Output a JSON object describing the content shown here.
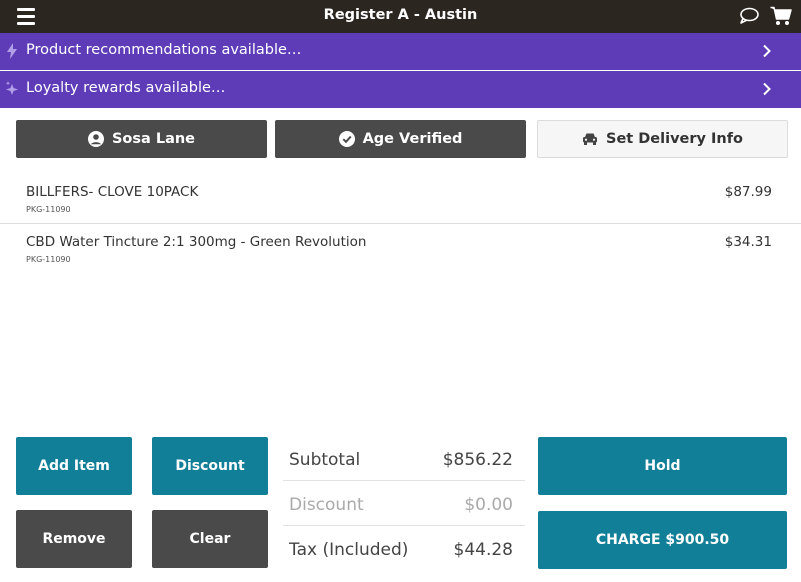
{
  "header": {
    "title": "Register A - Austin",
    "menu_icon": "hamburger-icon",
    "chat_icon": "chat-bubble-icon",
    "cart_icon": "cart-icon",
    "background": "#2c2621"
  },
  "banners": [
    {
      "text": "Product recommendations available…",
      "icon": "lightning-icon"
    },
    {
      "text": "Loyalty rewards available…",
      "icon": "sparkle-icon"
    }
  ],
  "banner_color": "#5e3cb8",
  "actions": {
    "customer": {
      "label": "Sosa Lane",
      "icon": "user-circle-icon"
    },
    "age": {
      "label": "Age Verified",
      "icon": "check-circle-icon"
    },
    "delivery": {
      "label": "Set Delivery Info",
      "icon": "car-icon"
    }
  },
  "cart_items": [
    {
      "name": "BILLFERS- CLOVE 10PACK",
      "sku": "PKG-11090",
      "price": "$87.99"
    },
    {
      "name": "CBD Water Tincture 2:1 300mg - Green Revolution",
      "sku": "PKG-11090",
      "price": "$34.31"
    }
  ],
  "buttons": {
    "add_item": "Add Item",
    "discount": "Discount",
    "remove": "Remove",
    "clear": "Clear",
    "hold": "Hold",
    "charge": "CHARGE $900.50"
  },
  "totals": {
    "subtotal_label": "Subtotal",
    "subtotal_value": "$856.22",
    "discount_label": "Discount",
    "discount_value": "$0.00",
    "tax_label": "Tax (Included)",
    "tax_value": "$44.28"
  },
  "colors": {
    "teal": "#127f98",
    "dark_gray": "#4a4a4a"
  }
}
